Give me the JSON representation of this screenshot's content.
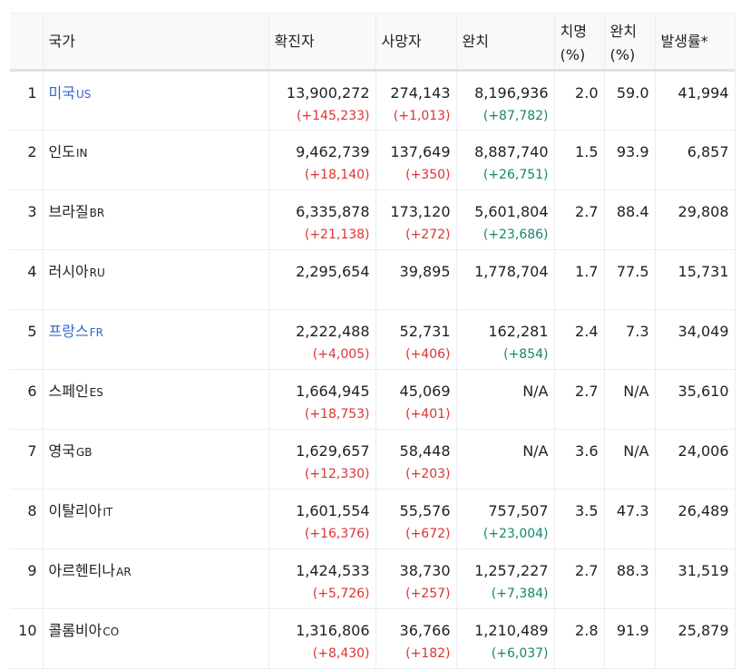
{
  "table": {
    "headers": {
      "rank": "",
      "country": "국가",
      "confirmed": "확진자",
      "deaths": "사망자",
      "recovered": "완치",
      "fatality_rate": "치명 (%)",
      "recovery_rate": "완치 (%)",
      "incidence": "발생률*"
    },
    "rows": [
      {
        "rank": "1",
        "country": "미국",
        "code": "US",
        "linked": true,
        "confirmed": "13,900,272",
        "confirmed_delta": "(+145,233)",
        "deaths": "274,143",
        "deaths_delta": "(+1,013)",
        "recovered": "8,196,936",
        "recovered_delta": "(+87,782)",
        "fatality": "2.0",
        "recovery": "59.0",
        "incidence": "41,994"
      },
      {
        "rank": "2",
        "country": "인도",
        "code": "IN",
        "linked": false,
        "confirmed": "9,462,739",
        "confirmed_delta": "(+18,140)",
        "deaths": "137,649",
        "deaths_delta": "(+350)",
        "recovered": "8,887,740",
        "recovered_delta": "(+26,751)",
        "fatality": "1.5",
        "recovery": "93.9",
        "incidence": "6,857"
      },
      {
        "rank": "3",
        "country": "브라질",
        "code": "BR",
        "linked": false,
        "confirmed": "6,335,878",
        "confirmed_delta": "(+21,138)",
        "deaths": "173,120",
        "deaths_delta": "(+272)",
        "recovered": "5,601,804",
        "recovered_delta": "(+23,686)",
        "fatality": "2.7",
        "recovery": "88.4",
        "incidence": "29,808"
      },
      {
        "rank": "4",
        "country": "러시아",
        "code": "RU",
        "linked": false,
        "confirmed": "2,295,654",
        "confirmed_delta": "",
        "deaths": "39,895",
        "deaths_delta": "",
        "recovered": "1,778,704",
        "recovered_delta": "",
        "fatality": "1.7",
        "recovery": "77.5",
        "incidence": "15,731"
      },
      {
        "rank": "5",
        "country": "프랑스",
        "code": "FR",
        "linked": true,
        "confirmed": "2,222,488",
        "confirmed_delta": "(+4,005)",
        "deaths": "52,731",
        "deaths_delta": "(+406)",
        "recovered": "162,281",
        "recovered_delta": "(+854)",
        "fatality": "2.4",
        "recovery": "7.3",
        "incidence": "34,049"
      },
      {
        "rank": "6",
        "country": "스페인",
        "code": "ES",
        "linked": false,
        "confirmed": "1,664,945",
        "confirmed_delta": "(+18,753)",
        "deaths": "45,069",
        "deaths_delta": "(+401)",
        "recovered": "N/A",
        "recovered_delta": "",
        "fatality": "2.7",
        "recovery": "N/A",
        "incidence": "35,610"
      },
      {
        "rank": "7",
        "country": "영국",
        "code": "GB",
        "linked": false,
        "confirmed": "1,629,657",
        "confirmed_delta": "(+12,330)",
        "deaths": "58,448",
        "deaths_delta": "(+203)",
        "recovered": "N/A",
        "recovered_delta": "",
        "fatality": "3.6",
        "recovery": "N/A",
        "incidence": "24,006"
      },
      {
        "rank": "8",
        "country": "이탈리아",
        "code": "IT",
        "linked": false,
        "confirmed": "1,601,554",
        "confirmed_delta": "(+16,376)",
        "deaths": "55,576",
        "deaths_delta": "(+672)",
        "recovered": "757,507",
        "recovered_delta": "(+23,004)",
        "fatality": "3.5",
        "recovery": "47.3",
        "incidence": "26,489"
      },
      {
        "rank": "9",
        "country": "아르헨티나",
        "code": "AR",
        "linked": false,
        "confirmed": "1,424,533",
        "confirmed_delta": "(+5,726)",
        "deaths": "38,730",
        "deaths_delta": "(+257)",
        "recovered": "1,257,227",
        "recovered_delta": "(+7,384)",
        "fatality": "2.7",
        "recovery": "88.3",
        "incidence": "31,519"
      },
      {
        "rank": "10",
        "country": "콜롬비아",
        "code": "CO",
        "linked": false,
        "confirmed": "1,316,806",
        "confirmed_delta": "(+8,430)",
        "deaths": "36,766",
        "deaths_delta": "(+182)",
        "recovered": "1,210,489",
        "recovered_delta": "(+6,037)",
        "fatality": "2.8",
        "recovery": "91.9",
        "incidence": "25,879"
      }
    ]
  },
  "colors": {
    "link": "#3366cc",
    "increase_red": "#dd3333",
    "recovered_green": "#14866d",
    "header_bg": "#f8f9fa",
    "border": "#eaecf0"
  }
}
